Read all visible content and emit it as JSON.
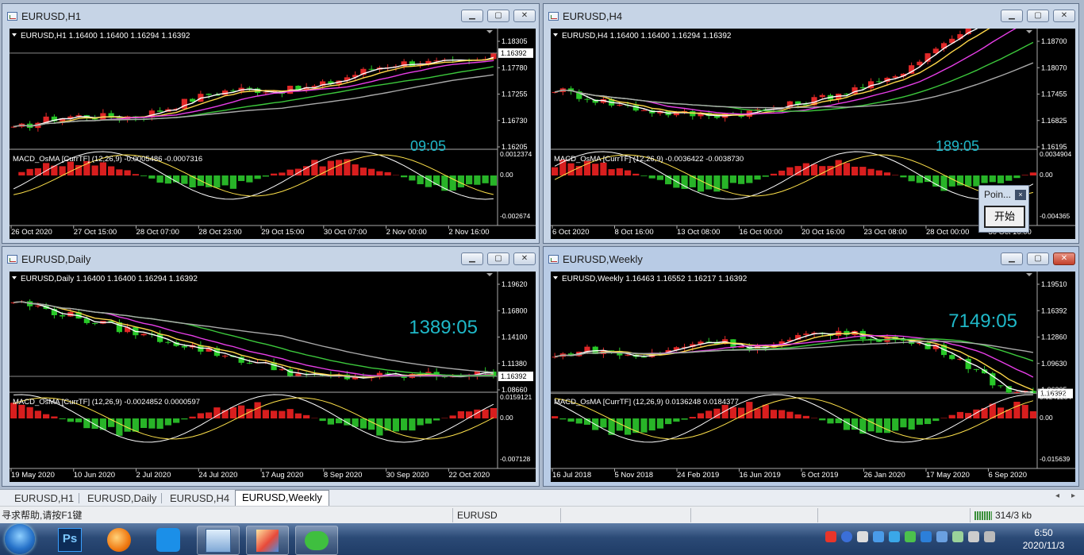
{
  "windows": [
    {
      "title": "EURUSD,H1",
      "info": "EURUSD,H1  1.16400 1.16400 1.16294 1.16392",
      "countdown": "09:05",
      "price_levels": [
        "1.18305",
        "1.17780",
        "1.17255",
        "1.16730",
        "1.16205"
      ],
      "current_price": "1.16392",
      "macd_label": "MACD_OsMA [CurrTF] (12,26,9) -0.0005486 -0.0007316",
      "macd_levels": [
        "0.0012374",
        "0.00",
        "-0.002674"
      ],
      "dates": [
        "26 Oct 2020",
        "27 Oct 15:00",
        "28 Oct 07:00",
        "28 Oct 23:00",
        "29 Oct 15:00",
        "30 Oct 07:00",
        "2 Nov 00:00",
        "2 Nov 16:00"
      ]
    },
    {
      "title": "EURUSD,H4",
      "info": "EURUSD,H4  1.16400 1.16400 1.16294 1.16392",
      "countdown": "189:05",
      "price_levels": [
        "1.18700",
        "1.18070",
        "1.17455",
        "1.16825",
        "1.16195"
      ],
      "current_price": "1.16392",
      "macd_label": "MACD_OsMA [CurrTF] (12,26,9) -0.0036422 -0.0038730",
      "macd_levels": [
        "0.0034904",
        "0.00",
        "-0.004365"
      ],
      "dates": [
        "6 Oct 2020",
        "8 Oct 16:00",
        "13 Oct 08:00",
        "16 Oct 00:00",
        "20 Oct 16:00",
        "23 Oct 08:00",
        "28 Oct 00:00",
        "30 Oct 16:00"
      ]
    },
    {
      "title": "EURUSD,Daily",
      "info": "EURUSD,Daily  1.16400 1.16400 1.16294 1.16392",
      "countdown": "1389:05",
      "price_levels": [
        "1.19620",
        "1.16800",
        "1.14100",
        "1.11380",
        "1.08660"
      ],
      "current_price": "1.16392",
      "macd_label": "MACD_OsMA [CurrTF] (12,26,9) -0.0024852 0.0000597",
      "macd_levels": [
        "0.0159121",
        "0.00",
        "-0.007128"
      ],
      "dates": [
        "19 May 2020",
        "10 Jun 2020",
        "2 Jul 2020",
        "24 Jul 2020",
        "17 Aug 2020",
        "8 Sep 2020",
        "30 Sep 2020",
        "22 Oct 2020"
      ]
    },
    {
      "title": "EURUSD,Weekly",
      "info": "EURUSD,Weekly  1.16463 1.16552 1.16217 1.16392",
      "countdown": "7149:05",
      "price_levels": [
        "1.19510",
        "1.16392",
        "1.12860",
        "1.09630",
        "1.06305"
      ],
      "current_price": "1.16392",
      "macd_label": "MACD_OsMA [CurrTF] (12,26,9) 0.0136248 0.0184377",
      "macd_levels": [
        "0.0241284",
        "0.00",
        "-0.015639"
      ],
      "dates": [
        "16 Jul 2018",
        "5 Nov 2018",
        "24 Feb 2019",
        "16 Jun 2019",
        "6 Oct 2019",
        "26 Jan 2020",
        "17 May 2020",
        "6 Sep 2020"
      ]
    }
  ],
  "popup": {
    "title": "Poin...",
    "close": "×",
    "button": "开始"
  },
  "tabs": [
    "EURUSD,H1",
    "EURUSD,Daily",
    "EURUSD,H4",
    "EURUSD,Weekly"
  ],
  "status": {
    "help": "寻求帮助,请按F1键",
    "symbol": "EURUSD",
    "traffic": "314/3 kb"
  },
  "taskbar": {
    "ps_label": "Ps",
    "time": "6:50",
    "date": "2020/11/3"
  }
}
